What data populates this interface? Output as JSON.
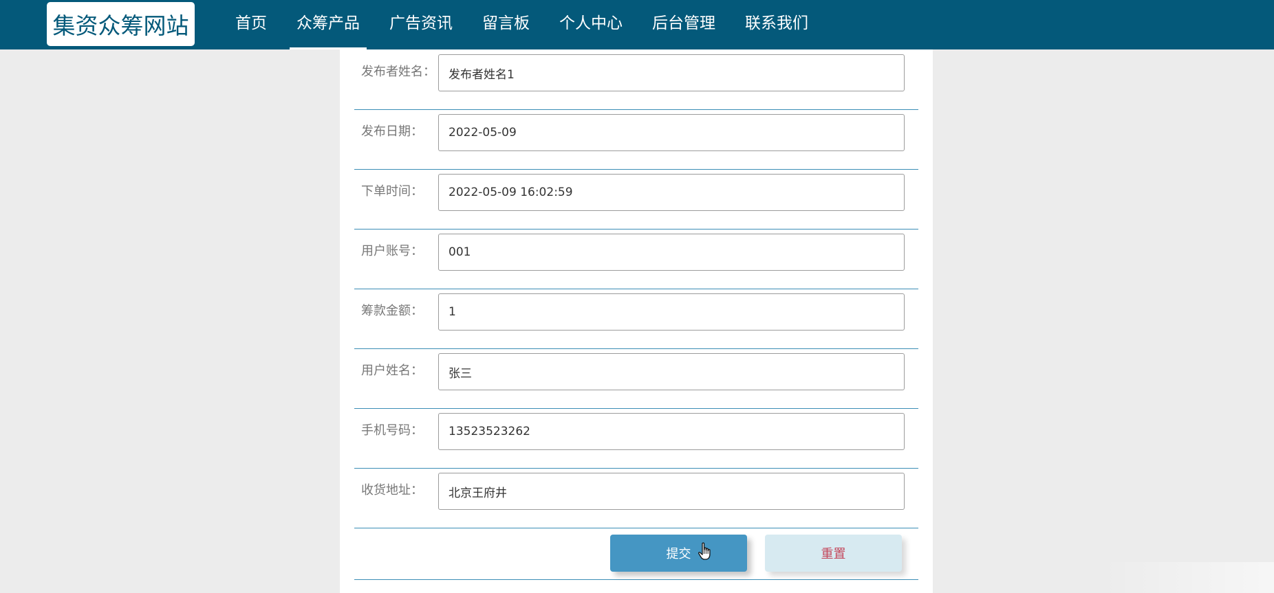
{
  "header": {
    "logo_text": "集资众筹网站",
    "nav": [
      {
        "label": "首页",
        "active": false
      },
      {
        "label": "众筹产品",
        "active": true
      },
      {
        "label": "广告资讯",
        "active": false
      },
      {
        "label": "留言板",
        "active": false
      },
      {
        "label": "个人中心",
        "active": false
      },
      {
        "label": "后台管理",
        "active": false
      },
      {
        "label": "联系我们",
        "active": false
      }
    ]
  },
  "form": {
    "fields": [
      {
        "label": "发布者姓名：",
        "value": "发布者姓名1"
      },
      {
        "label": "发布日期：",
        "value": "2022-05-09"
      },
      {
        "label": "下单时间：",
        "value": "2022-05-09 16:02:59"
      },
      {
        "label": "用户账号：",
        "value": "001"
      },
      {
        "label": "筹款金额：",
        "value": "1"
      },
      {
        "label": "用户姓名：",
        "value": "张三"
      },
      {
        "label": "手机号码：",
        "value": "13523523262"
      },
      {
        "label": "收货地址：",
        "value": "北京王府井"
      }
    ],
    "submit_label": "提交",
    "reset_label": "重置"
  },
  "colors": {
    "header_bg": "#04597a",
    "submit_bg": "#4596c3",
    "reset_bg": "#d7eaf1",
    "reset_text": "#c44a5e",
    "row_divider": "#3a8db5"
  },
  "icons": {
    "cursor": "hand-pointer-icon"
  }
}
